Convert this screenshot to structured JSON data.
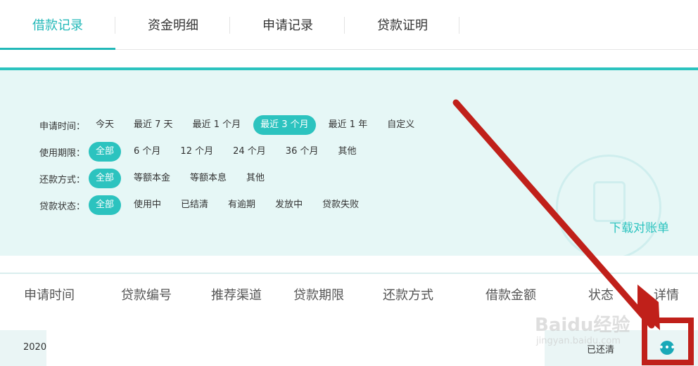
{
  "tabs": [
    "借款记录",
    "资金明细",
    "申请记录",
    "贷款证明"
  ],
  "filters": {
    "apply_time": {
      "label": "申请时间：",
      "options": [
        "今天",
        "最近 7 天",
        "最近 1 个月",
        "最近 3 个月",
        "最近 1 年",
        "自定义"
      ],
      "selected": "最近 3 个月"
    },
    "term": {
      "label": "使用期限：",
      "options": [
        "全部",
        "6 个月",
        "12 个月",
        "24 个月",
        "36 个月",
        "其他"
      ],
      "selected": "全部"
    },
    "repayment": {
      "label": "还款方式：",
      "options": [
        "全部",
        "等额本金",
        "等额本息",
        "其他"
      ],
      "selected": "全部"
    },
    "status": {
      "label": "贷款状态：",
      "options": [
        "全部",
        "使用中",
        "已结清",
        "有逾期",
        "发放中",
        "贷款失败"
      ],
      "selected": "全部"
    }
  },
  "download_link": "下载对账单",
  "table": {
    "columns": [
      "申请时间",
      "贷款编号",
      "推荐渠道",
      "贷款期限",
      "还款方式",
      "借款金额",
      "状态",
      "详情"
    ],
    "row": {
      "date": "2020",
      "status": "已还清",
      "detail_icon": "more-icon"
    }
  },
  "watermark": {
    "main": "Baidu经验",
    "sub": "jingyan.baidu.com"
  },
  "colors": {
    "accent": "#2cc3bf",
    "panel_bg": "#e6f7f6",
    "annotation": "#c0201a"
  }
}
